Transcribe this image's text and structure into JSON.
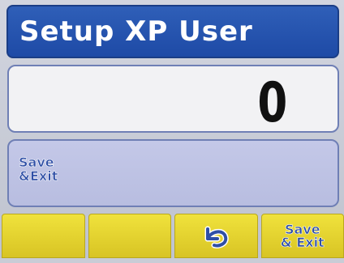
{
  "header": {
    "title": "Setup XP User"
  },
  "value_display": {
    "value": "0"
  },
  "menu": {
    "items": [
      {
        "label": "Save\n&Exit"
      }
    ]
  },
  "softkeys": [
    {
      "label": "",
      "icon": ""
    },
    {
      "label": "",
      "icon": ""
    },
    {
      "label": "",
      "icon": "back-arrow-icon"
    },
    {
      "label": "Save\n& Exit",
      "icon": ""
    }
  ],
  "colors": {
    "header_bg": "#1e4aa6",
    "softkey_bg": "#e6d430",
    "menu_text": "#2f4fa6"
  }
}
